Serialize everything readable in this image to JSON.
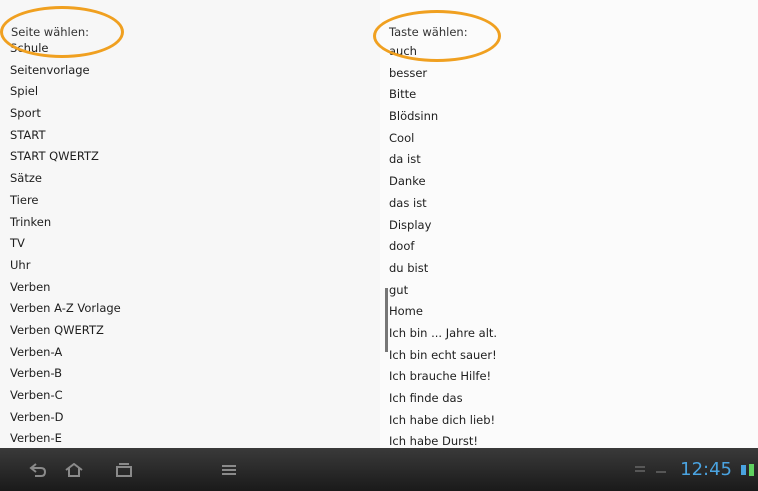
{
  "left": {
    "header": "Seite wählen:",
    "items": [
      "Schule",
      "Seitenvorlage",
      "Spiel",
      "Sport",
      "START",
      "START QWERTZ",
      "Sätze",
      "Tiere",
      "Trinken",
      "TV",
      "Uhr",
      "Verben",
      "Verben A-Z Vorlage",
      "Verben QWERTZ",
      "Verben-A",
      "Verben-B",
      "Verben-C",
      "Verben-D",
      "Verben-E"
    ]
  },
  "right": {
    "header": "Taste wählen:",
    "items": [
      "auch",
      "besser",
      "Bitte",
      "Blödsinn",
      "Cool",
      "da ist",
      "Danke",
      "das ist",
      "Display",
      "doof",
      "du bist",
      "gut",
      "Home",
      "Ich bin ... Jahre alt.",
      "Ich bin echt sauer!",
      "Ich brauche Hilfe!",
      "Ich finde das",
      "Ich habe dich lieb!",
      "Ich habe Durst!"
    ]
  },
  "navbar": {
    "clock": "12:45",
    "icons": [
      "back-icon",
      "home-icon",
      "recent-apps-icon",
      "menu-icon",
      "usb-icon",
      "notification-icon",
      "signal-icon",
      "battery-icon"
    ]
  },
  "colors": {
    "highlight": "#f0a020",
    "clock": "#4aa3e0"
  }
}
